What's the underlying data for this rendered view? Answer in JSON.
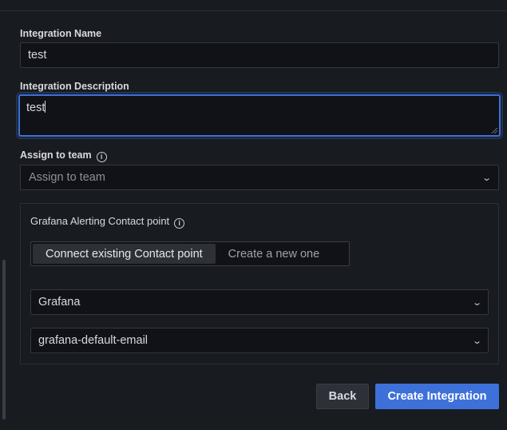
{
  "integration_name": {
    "label": "Integration Name",
    "value": "test"
  },
  "integration_description": {
    "label": "Integration Description",
    "value": "test"
  },
  "assign_team": {
    "label": "Assign to team",
    "placeholder": "Assign to team"
  },
  "contact_point": {
    "label": "Grafana Alerting Contact point",
    "options": [
      "Connect existing Contact point",
      "Create a new one"
    ],
    "selected_option": "Connect existing Contact point",
    "grafana_select": "Grafana",
    "contact_select": "grafana-default-email"
  },
  "buttons": {
    "back": "Back",
    "create": "Create Integration"
  },
  "colors": {
    "primary": "#3d71d9",
    "background": "#181b1f",
    "input_bg": "#111217"
  },
  "icons": {
    "info": "info-circle-icon",
    "chevron": "chevron-down-icon"
  }
}
